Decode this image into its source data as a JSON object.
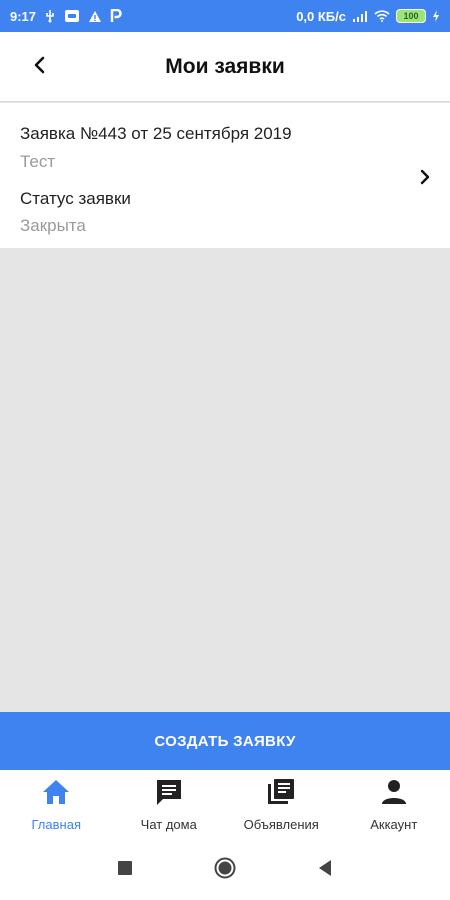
{
  "status_bar": {
    "time": "9:17",
    "network_speed": "0,0 КБ/с",
    "battery": "100",
    "accent_color": "#3f83f1",
    "battery_color": "#9ee27a"
  },
  "header": {
    "title": "Мои заявки",
    "back_icon": "chevron-left-icon"
  },
  "request": {
    "title": "Заявка №443 от 25 сентября 2019",
    "subtitle": "Тест",
    "status_label": "Статус заявки",
    "status_value": "Закрыта",
    "chevron_icon": "chevron-right-icon"
  },
  "create_button": {
    "label": "СОЗДАТЬ ЗАЯВКУ"
  },
  "bottom_nav": {
    "items": [
      {
        "label": "Главная",
        "icon": "home-icon",
        "active": true
      },
      {
        "label": "Чат дома",
        "icon": "chat-icon",
        "active": false
      },
      {
        "label": "Объявления",
        "icon": "news-icon",
        "active": false
      },
      {
        "label": "Аккаунт",
        "icon": "account-icon",
        "active": false
      }
    ]
  },
  "system_nav": {
    "buttons": [
      "recents-icon",
      "home-circle-icon",
      "back-triangle-icon"
    ]
  }
}
